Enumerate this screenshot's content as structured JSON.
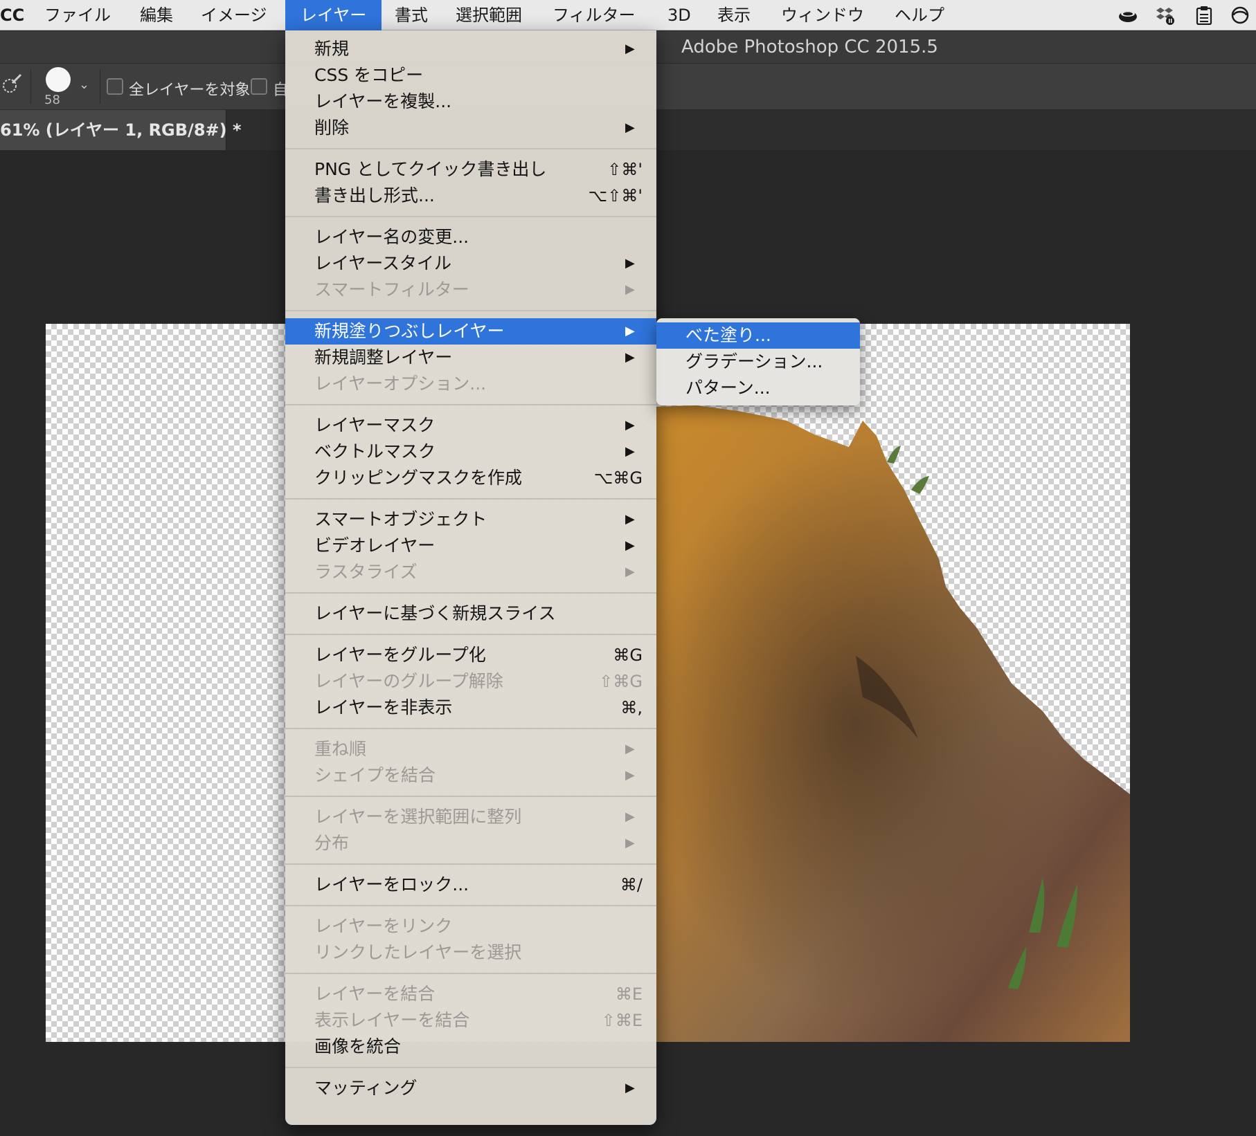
{
  "menubar": {
    "app": "CC",
    "items": [
      "ファイル",
      "編集",
      "イメージ",
      "レイヤー",
      "書式",
      "選択範囲",
      "フィルター",
      "3D",
      "表示",
      "ウィンドウ",
      "ヘルプ"
    ],
    "active": "レイヤー",
    "status_icons": [
      "coffee-icon",
      "dropbox-icon",
      "clipboard-icon",
      "sync-icon"
    ]
  },
  "ps": {
    "window_title": "Adobe Photoshop CC 2015.5",
    "options": {
      "brush_size": "58",
      "sample_all_layers": "全レイヤーを対象",
      "auto_enhance_partial": "自"
    },
    "document_tab": "61% (レイヤー 1, RGB/8#) *"
  },
  "layer_menu": {
    "items": [
      {
        "label": "新規",
        "submenu": true
      },
      {
        "label": "CSS をコピー"
      },
      {
        "label": "レイヤーを複製..."
      },
      {
        "label": "削除",
        "submenu": true
      },
      {
        "separator": true
      },
      {
        "label": "PNG としてクイック書き出し",
        "shortcut": "⇧⌘'"
      },
      {
        "label": "書き出し形式...",
        "shortcut": "⌥⇧⌘'"
      },
      {
        "separator": true
      },
      {
        "label": "レイヤー名の変更..."
      },
      {
        "label": "レイヤースタイル",
        "submenu": true
      },
      {
        "label": "スマートフィルター",
        "submenu": true,
        "disabled": true
      },
      {
        "separator": true
      },
      {
        "label": "新規塗りつぶしレイヤー",
        "submenu": true,
        "highlighted": true
      },
      {
        "label": "新規調整レイヤー",
        "submenu": true
      },
      {
        "label": "レイヤーオプション...",
        "disabled": true
      },
      {
        "separator": true
      },
      {
        "label": "レイヤーマスク",
        "submenu": true
      },
      {
        "label": "ベクトルマスク",
        "submenu": true
      },
      {
        "label": "クリッピングマスクを作成",
        "shortcut": "⌥⌘G"
      },
      {
        "separator": true
      },
      {
        "label": "スマートオブジェクト",
        "submenu": true
      },
      {
        "label": "ビデオレイヤー",
        "submenu": true
      },
      {
        "label": "ラスタライズ",
        "submenu": true,
        "disabled": true
      },
      {
        "separator": true
      },
      {
        "label": "レイヤーに基づく新規スライス"
      },
      {
        "separator": true
      },
      {
        "label": "レイヤーをグループ化",
        "shortcut": "⌘G"
      },
      {
        "label": "レイヤーのグループ解除",
        "shortcut": "⇧⌘G",
        "disabled": true
      },
      {
        "label": "レイヤーを非表示",
        "shortcut": "⌘,"
      },
      {
        "separator": true
      },
      {
        "label": "重ね順",
        "submenu": true,
        "disabled": true
      },
      {
        "label": "シェイプを結合",
        "submenu": true,
        "disabled": true
      },
      {
        "separator": true
      },
      {
        "label": "レイヤーを選択範囲に整列",
        "submenu": true,
        "disabled": true
      },
      {
        "label": "分布",
        "submenu": true,
        "disabled": true
      },
      {
        "separator": true
      },
      {
        "label": "レイヤーをロック...",
        "shortcut": "⌘/"
      },
      {
        "separator": true
      },
      {
        "label": "レイヤーをリンク",
        "disabled": true
      },
      {
        "label": "リンクしたレイヤーを選択",
        "disabled": true
      },
      {
        "separator": true
      },
      {
        "label": "レイヤーを結合",
        "shortcut": "⌘E",
        "disabled": true
      },
      {
        "label": "表示レイヤーを結合",
        "shortcut": "⇧⌘E",
        "disabled": true
      },
      {
        "label": "画像を統合"
      },
      {
        "separator": true
      },
      {
        "label": "マッティング",
        "submenu": true
      }
    ]
  },
  "fill_submenu": {
    "items": [
      {
        "label": "べた塗り...",
        "highlighted": true
      },
      {
        "label": "グラデーション..."
      },
      {
        "label": "パターン..."
      }
    ]
  },
  "colors": {
    "highlight": "#2f74db",
    "workspace": "#282828"
  }
}
